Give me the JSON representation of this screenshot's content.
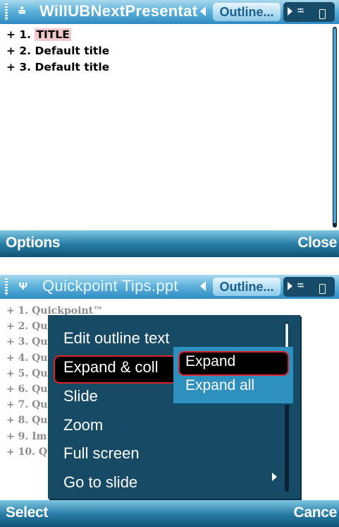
{
  "screen1": {
    "title_icon": "⩮",
    "document_title": "WillUBNextPresentati",
    "view_tab": "Outline...",
    "outline_items": [
      {
        "prefix": "+ 1. ",
        "title": "TITLE"
      },
      {
        "prefix": "+ 2. ",
        "title": "Default title"
      },
      {
        "prefix": "+ 3. ",
        "title": "Default title"
      }
    ],
    "softkeys": {
      "left": "Options",
      "right": "Close"
    }
  },
  "screen2": {
    "title_icon": "ᴪ",
    "document_title": "Quickpoint Tips.ppt",
    "view_tab": "Outline...",
    "outline_items": [
      "+ 1. Quickpoint™",
      "+ 2. Qu",
      "+ 3. Qu",
      "+ 4. Qu",
      "+ 5. Qu",
      "+ 6. Qu",
      "+ 7. Qu",
      "+ 8. Qu",
      "+ 9. Im",
      "+ 10. Q"
    ],
    "menu_items": [
      "Edit outline text",
      "Expand & coll",
      "Slide",
      "Zoom",
      "Full screen",
      "Go to slide"
    ],
    "submenu_items": [
      "Expand",
      "Expand all"
    ],
    "softkeys": {
      "left": "Select",
      "right": "Cance"
    }
  },
  "icons": {
    "usb": "usb-icon",
    "battery": "battery-icon",
    "left_arrow": "left-arrow-icon",
    "right_arrow": "right-arrow-icon"
  },
  "colors": {
    "titlebar": "#5fb3dc",
    "menu_bg": "#164a65",
    "submenu_bg": "#2e90bf",
    "selection_border": "#d8232a",
    "highlight": "#f4c9cc"
  }
}
